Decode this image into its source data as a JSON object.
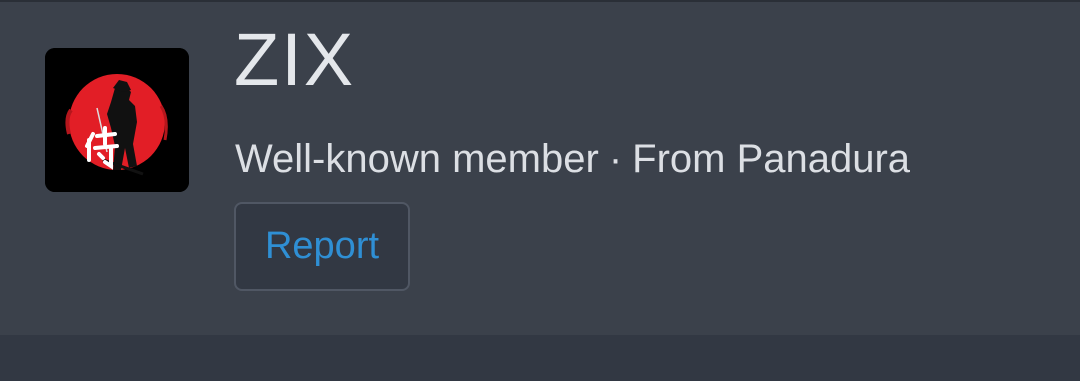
{
  "profile": {
    "username": "ZIX",
    "title": "Well-known member",
    "separator": "·",
    "location": "From Panadura",
    "report_label": "Report",
    "avatar_icon": "samurai-kanji-avatar"
  },
  "colors": {
    "card_background": "#3b414b",
    "page_background": "#323843",
    "username_text": "#e4e7eb",
    "report_link": "#2f8fd4",
    "avatar_red": "#e21e26"
  }
}
